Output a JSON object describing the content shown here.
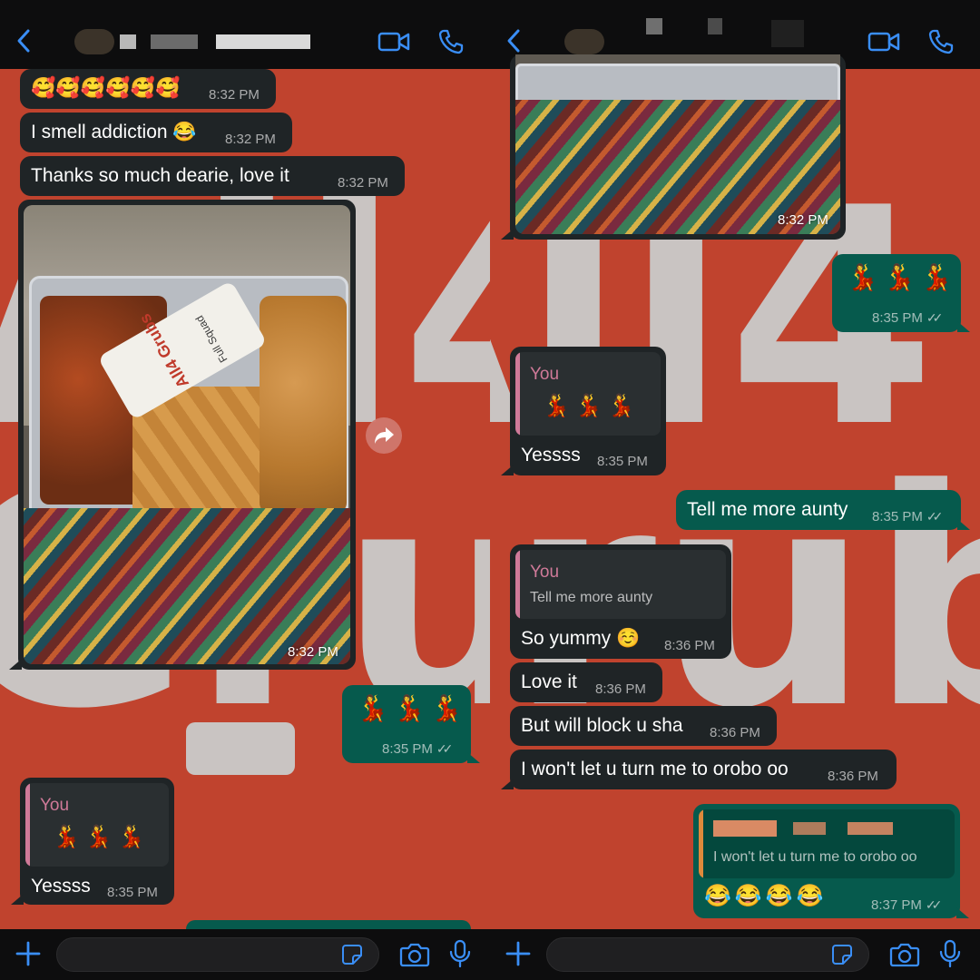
{
  "left": {
    "header": {
      "back_icon": "chevron-left-icon",
      "video_icon": "video-camera-icon",
      "call_icon": "phone-icon"
    },
    "messages": [
      {
        "kind": "emoji",
        "emoji": [
          "🥰",
          "🥰",
          "🥰",
          "🥰",
          "🥰",
          "🥰"
        ],
        "time": "8:32 PM"
      },
      {
        "kind": "text",
        "text": "I smell addiction 😂",
        "time": "8:32 PM"
      },
      {
        "kind": "text",
        "text": "Thanks so much dearie, love it",
        "time": "8:32 PM"
      },
      {
        "kind": "photo",
        "time": "8:32 PM",
        "label_brand": "All4 Grubs",
        "label_sub": "Full Squad"
      },
      {
        "kind": "emoji_out",
        "emoji": [
          "💃",
          "💃",
          "💃"
        ],
        "time": "8:35 PM"
      },
      {
        "kind": "reply",
        "quote_author": "You",
        "quote_emoji": [
          "💃",
          "💃",
          "💃"
        ],
        "text": "Yessss",
        "time": "8:35 PM"
      }
    ],
    "footer": {
      "plus_icon": "plus-icon",
      "sticker_icon": "sticker-icon",
      "camera_icon": "camera-icon",
      "mic_icon": "microphone-icon"
    }
  },
  "right": {
    "header": {
      "back_icon": "chevron-left-icon",
      "video_icon": "video-camera-icon",
      "call_icon": "phone-icon"
    },
    "messages": [
      {
        "kind": "photo",
        "time": "8:32 PM"
      },
      {
        "kind": "emoji_out",
        "emoji": [
          "💃",
          "💃",
          "💃"
        ],
        "time": "8:35 PM"
      },
      {
        "kind": "reply",
        "quote_author": "You",
        "quote_emoji": [
          "💃",
          "💃",
          "💃"
        ],
        "text": "Yessss",
        "time": "8:35 PM"
      },
      {
        "kind": "text_out",
        "text": "Tell me more aunty",
        "time": "8:35 PM"
      },
      {
        "kind": "reply",
        "quote_author": "You",
        "quote_text": "Tell me more aunty",
        "text": "So yummy ☺️",
        "time": "8:36 PM"
      },
      {
        "kind": "text",
        "text": "Love it",
        "time": "8:36 PM"
      },
      {
        "kind": "text",
        "text": "But will block u sha",
        "time": "8:36 PM"
      },
      {
        "kind": "text",
        "text": "I won't let u turn me to orobo oo",
        "time": "8:36 PM"
      },
      {
        "kind": "reply_out",
        "quote_text": "I won't let u turn me to orobo oo",
        "emoji": [
          "😂",
          "😂",
          "😂",
          "😂"
        ],
        "time": "8:37 PM"
      }
    ],
    "footer": {
      "plus_icon": "plus-icon",
      "sticker_icon": "sticker-icon",
      "camera_icon": "camera-icon",
      "mic_icon": "microphone-icon"
    }
  },
  "wallpaper": {
    "text_top": "All4",
    "text_bottom": "Grub"
  },
  "colors": {
    "wallpaper": "#c0432e",
    "incoming_bubble": "#1f2426",
    "outgoing_bubble": "#065a4d",
    "accent_blue": "#3a8ef6",
    "quote_author": "#d07a99"
  }
}
